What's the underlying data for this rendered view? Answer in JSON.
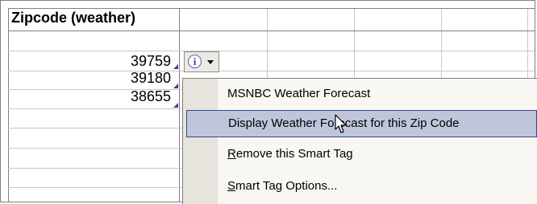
{
  "spreadsheet": {
    "header": "Zipcode (weather)",
    "zipcodes": [
      "39759",
      "39180",
      "38655"
    ]
  },
  "smart_tag": {
    "icon": "info-icon",
    "icon_glyph": "i"
  },
  "menu": {
    "items": [
      {
        "pre": "",
        "acc": "",
        "post": "MSNBC Weather Forecast",
        "selected": false
      },
      {
        "pre": "",
        "acc": "",
        "post": "Display Weather Forecast for this Zip Code",
        "selected": true
      },
      {
        "pre": "",
        "acc": "R",
        "post": "emove this Smart Tag",
        "selected": false
      },
      {
        "pre": "",
        "acc": "S",
        "post": "mart Tag Options...",
        "selected": false
      }
    ]
  },
  "colors": {
    "selection_fill": "#bfc6dc",
    "selection_border": "#33468c",
    "tag_marker": "#6a2a8a",
    "menu_gutter": "#e6e4dc"
  }
}
